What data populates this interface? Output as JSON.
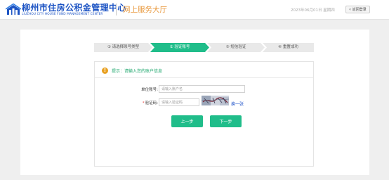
{
  "header": {
    "logo_cn": "柳州市住房公积金管理中心",
    "logo_en": "LIUZHOU CITY HOUSE FUND MANAGEMENT CENTER",
    "portal_title": "网上服务大厅",
    "datetime": "2023年06月01日 星期四",
    "login_button": "返回登录",
    "logo_icon": "house-logo-icon",
    "back_icon": "chevron-left-icon"
  },
  "steps": [
    {
      "label": "① 请选择账号类型",
      "active": false
    },
    {
      "label": "② 验证账号",
      "active": true
    },
    {
      "label": "③ 短信验证",
      "active": false
    },
    {
      "label": "④ 重置成功",
      "active": false
    }
  ],
  "form": {
    "tip": "提示：请输入您的账户信息",
    "tip_icon": "exclamation-icon",
    "account_label": "单位账号:",
    "account_placeholder": "请输入账户名",
    "account_value": "",
    "code_required_mark": "*",
    "code_label": "验证码:",
    "code_placeholder": "请输入验证码",
    "code_value": "",
    "refresh_link": "换一张",
    "prev_button": "上一步",
    "next_button": "下一步"
  },
  "colors": {
    "brand_blue": "#1d54c4",
    "accent_green": "#20bd8a",
    "tip_orange": "#e8a020",
    "portal_orange": "#e8973a",
    "required_red": "#e53935"
  }
}
